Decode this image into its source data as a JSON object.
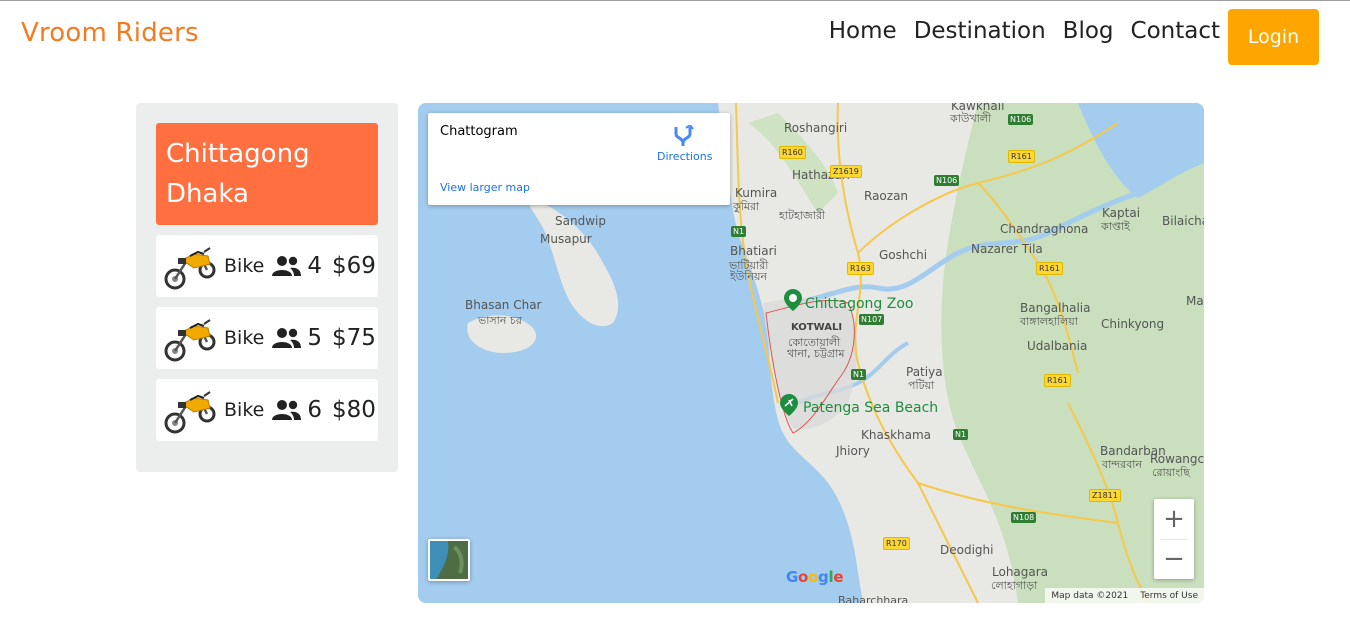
{
  "header": {
    "brand": "Vroom Riders",
    "nav": [
      "Home",
      "Destination",
      "Blog",
      "Contact"
    ],
    "login_label": "Login",
    "accent_color": "#f47b20",
    "login_color": "#ffa500"
  },
  "search_result": {
    "route_from": "Chittagong",
    "route_to": "Dhaka",
    "route_color": "#ff6f40",
    "rides": [
      {
        "vehicle": "Bike",
        "icon": "motorbike-icon",
        "capacity": "4",
        "price": "$69"
      },
      {
        "vehicle": "Bike",
        "icon": "motorbike-icon",
        "capacity": "5",
        "price": "$75"
      },
      {
        "vehicle": "Bike",
        "icon": "motorbike-icon",
        "capacity": "6",
        "price": "$80"
      }
    ]
  },
  "map": {
    "place": "Chattogram",
    "directions": "Directions",
    "view_larger": "View larger map",
    "zoom_in": "+",
    "zoom_out": "−",
    "attribution": "Map data ©2021",
    "terms": "Terms of Use",
    "labels": {
      "kawkhali": "Kawkhali",
      "kawkhali_bn": "কাউখালী",
      "roshangiri": "Roshangiri",
      "kumira": "Kumira",
      "kumira_bn": "কুমিরা",
      "hathazari": "Hathazari",
      "hathazari_bn": "হাটহাজারী",
      "raozan": "Raozan",
      "sandwip": "Sandwip",
      "musapur": "Musapur",
      "chandraghona": "Chandraghona",
      "kaptai": "Kaptai",
      "kaptai_bn": "কাপ্তাই",
      "bilaichari": "Bilaicha",
      "goshchi": "Goshchi",
      "nazarer_tila": "Nazarer Tila",
      "bhatiari": "Bhatiari",
      "bhatiari_bn": "ভাটিয়ারী",
      "bhatiari_bn2": "ইউনিয়ন",
      "bhasan_char": "Bhasan Char",
      "bhasan_char_bn": "ভাসান চর",
      "chittagong_zoo": "Chittagong Zoo",
      "bangalhalia": "Bangalhalia",
      "bangalhalia_bn": "বাঙ্গালহালিয়া",
      "chinkyong": "Chinkyong",
      "ma": "Ma",
      "kotwali": "KOTWALI",
      "kotwali_bn": "কোতোয়ালী",
      "kotwali_bn2": "থানা, চট্টগ্রাম",
      "udalbania": "Udalbania",
      "patiya": "Patiya",
      "patiya_bn": "পটিয়া",
      "patenga": "Patenga Sea Beach",
      "khaskhama": "Khaskhama",
      "jhiory": "Jhiory",
      "bandarban": "Bandarban",
      "bandarban_bn": "বান্দরবান",
      "rowangchhari": "Rowangch",
      "rowangchhari_bn": "রোয়াংছি",
      "deodighi": "Deodighi",
      "lohagara": "Lohagara",
      "lohagara_bn": "লোহাগাড়া",
      "baharchhara": "Baharchhara"
    },
    "roads": [
      "N106",
      "R160",
      "Z1619",
      "N106",
      "R161",
      "N1",
      "R163",
      "N107",
      "R161",
      "N1",
      "N1",
      "R161",
      "Z1811",
      "N108",
      "R170"
    ],
    "water_color": "#a3ccee",
    "land_color": "#e8e8e4",
    "forest_color": "#c9dfbd"
  }
}
